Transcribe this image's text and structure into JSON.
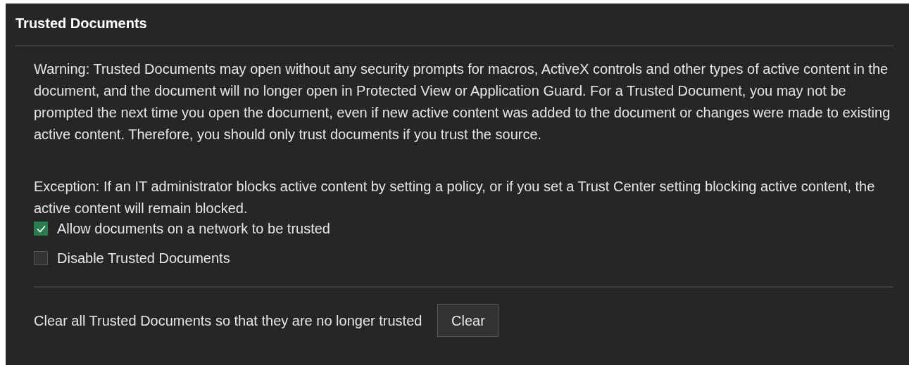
{
  "section": {
    "title": "Trusted Documents"
  },
  "paragraphs": [
    "Warning: Trusted Documents may open without any security prompts for macros, ActiveX controls and other types of active content in the document, and the document will no longer open in Protected View or Application Guard. For a Trusted Document, you may not be prompted the next time you open the document, even if new active content was added to the document or changes were made to existing active content. Therefore, you should only trust documents if you trust the source.",
    "Exception: If an IT administrator blocks active content by setting a policy, or if you set a Trust Center setting blocking active content, the active content will remain blocked."
  ],
  "options": [
    {
      "label": "Allow documents on a network to be trusted",
      "checked": true
    },
    {
      "label": "Disable Trusted Documents",
      "checked": false
    }
  ],
  "clear_row": {
    "label": "Clear all Trusted Documents so that they are no longer trusted",
    "button": "Clear"
  }
}
